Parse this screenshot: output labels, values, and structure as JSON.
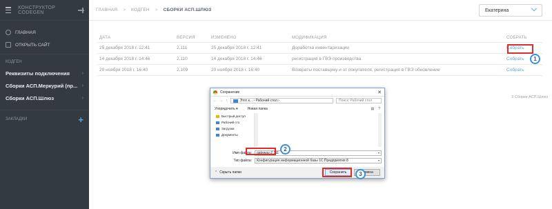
{
  "sidebar": {
    "app_title": "КОНСТРУКТОР CODEGEN",
    "items": [
      {
        "label": "ГЛАВНАЯ"
      },
      {
        "label": "ОТКРЫТЬ САЙТ"
      }
    ],
    "section_codegen": "КОДГЕН",
    "groups": [
      {
        "label": "Реквизиты подключения"
      },
      {
        "label": "Сборки АСП.Меркурий (пр..."
      },
      {
        "label": "Сборки АСП.Шлюз"
      }
    ],
    "bookmarks_label": "ЗАКЛАДКИ"
  },
  "header": {
    "breadcrumbs": [
      "ГЛАВНАЯ",
      "КОДГЕН",
      "СБОРКИ АСП.ШЛЮЗ"
    ],
    "user": "Екатерина"
  },
  "table": {
    "columns": [
      "ДАТА",
      "ВЕРСИЯ",
      "ИЗМЕНЕНО",
      "МОДИФИКАЦИЯ",
      "СОБРАТЬ"
    ],
    "rows": [
      {
        "date": "25 декабря 2018 г. 12:41",
        "version": "2,111",
        "changed": "25 декабря 2018 г. 12:41",
        "mod": "Доработка инвентаризации",
        "action": "Собрать"
      },
      {
        "date": "14 декабря 2018 г. 14:46",
        "version": "2,110",
        "changed": "14 декабря 2018 г. 14:46",
        "mod": "регистрация в ГВЭ производства",
        "action": "Собрать"
      },
      {
        "date": "20 ноября 2018 г. 16:40",
        "version": "2,109",
        "changed": "20 ноября 2018 г. 16:40",
        "mod": "Возвраты поставщику и от покупателя, регистрация в ГВЭ обновление",
        "action": "Собрать"
      }
    ],
    "count_text": "3 Сборки АСП.Шлюз"
  },
  "dialog": {
    "title": "Сохранение",
    "path": "Этот к... › Рабочий стол ›",
    "search_placeholder": "Поиск: Рабочий стол",
    "organize": "Упорядочить ▾",
    "new_folder": "Новая папка",
    "nav": [
      {
        "label": "Быстрый доступ"
      },
      {
        "label": "Рабочий сто"
      },
      {
        "label": "Загрузки"
      },
      {
        "label": "Документы"
      }
    ],
    "filename_label": "Имя файла:",
    "filename_value": "gateway-2,111",
    "filetype_label": "Тип файла:",
    "filetype_value": "Конфигурация информационной базы 1С:Предприятия 8",
    "hide_folders": "Скрыть папки",
    "save": "Сохранить",
    "cancel": "Отмена"
  },
  "callouts": [
    "1",
    "2",
    "3"
  ],
  "colors": {
    "accent": "#5aa6e0",
    "highlight": "#e22a2a",
    "sidebar": "#343a42"
  }
}
